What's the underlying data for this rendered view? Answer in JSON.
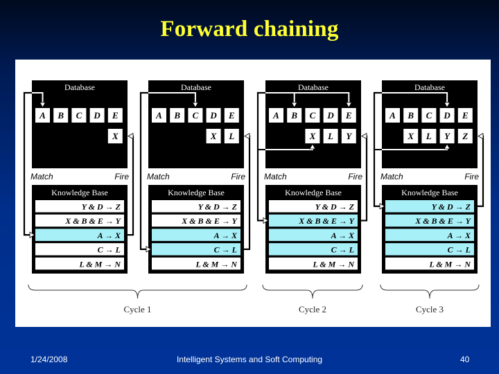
{
  "slide": {
    "title": "Forward chaining"
  },
  "diagram": {
    "panels": [
      {
        "database_label": "Database",
        "facts_row1": [
          "A",
          "B",
          "C",
          "D",
          "E"
        ],
        "facts_row2": [
          "X"
        ],
        "match_label": "Match",
        "fire_label": "Fire",
        "kb_label": "Knowledge Base",
        "rules": [
          {
            "text": "Y & D → Z",
            "active": false
          },
          {
            "text": "X & B & E → Y",
            "active": false
          },
          {
            "text": "A → X",
            "active": true
          },
          {
            "text": "C → L",
            "active": false
          },
          {
            "text": "L & M → N",
            "active": false
          }
        ],
        "matched_facts": [
          "A"
        ],
        "fired_rule_index": 2,
        "new_fact": "X"
      },
      {
        "database_label": "Database",
        "facts_row1": [
          "A",
          "B",
          "C",
          "D",
          "E"
        ],
        "facts_row2": [
          "X",
          "L"
        ],
        "match_label": "Match",
        "fire_label": "Fire",
        "kb_label": "Knowledge Base",
        "rules": [
          {
            "text": "Y & D → Z",
            "active": false
          },
          {
            "text": "X & B & E → Y",
            "active": false
          },
          {
            "text": "A → X",
            "active": true
          },
          {
            "text": "C → L",
            "active": true
          },
          {
            "text": "L & M → N",
            "active": false
          }
        ],
        "matched_facts": [
          "C"
        ],
        "fired_rule_index": 3,
        "new_fact": "L"
      },
      {
        "database_label": "Database",
        "facts_row1": [
          "A",
          "B",
          "C",
          "D",
          "E"
        ],
        "facts_row2": [
          "X",
          "L",
          "Y"
        ],
        "match_label": "Match",
        "fire_label": "Fire",
        "kb_label": "Knowledge Base",
        "rules": [
          {
            "text": "Y & D → Z",
            "active": false
          },
          {
            "text": "X & B & E → Y",
            "active": true
          },
          {
            "text": "A → X",
            "active": true
          },
          {
            "text": "C → L",
            "active": true
          },
          {
            "text": "L & M → N",
            "active": false
          }
        ],
        "matched_facts": [
          "B",
          "E",
          "X"
        ],
        "fired_rule_index": 1,
        "new_fact": "Y"
      },
      {
        "database_label": "Database",
        "facts_row1": [
          "A",
          "B",
          "C",
          "D",
          "E"
        ],
        "facts_row2": [
          "X",
          "L",
          "Y",
          "Z"
        ],
        "match_label": "Match",
        "fire_label": "Fire",
        "kb_label": "Knowledge Base",
        "rules": [
          {
            "text": "Y & D → Z",
            "active": true
          },
          {
            "text": "X & B & E → Y",
            "active": true
          },
          {
            "text": "A → X",
            "active": true
          },
          {
            "text": "C → L",
            "active": true
          },
          {
            "text": "L & M → N",
            "active": false
          }
        ],
        "matched_facts": [
          "D",
          "Y"
        ],
        "fired_rule_index": 0,
        "new_fact": "Z"
      }
    ],
    "cycles": [
      {
        "label": "Cycle 1",
        "panels": [
          0,
          1
        ]
      },
      {
        "label": "Cycle 2",
        "panels": [
          2
        ]
      },
      {
        "label": "Cycle 3",
        "panels": [
          3
        ]
      }
    ],
    "colors": {
      "active_rule": "#a8f0f8",
      "inactive_rule": "#ffffff",
      "box": "#000000",
      "title": "#ffff33"
    }
  },
  "footer": {
    "date": "1/24/2008",
    "course": "Intelligent Systems and Soft Computing",
    "page": "40"
  }
}
